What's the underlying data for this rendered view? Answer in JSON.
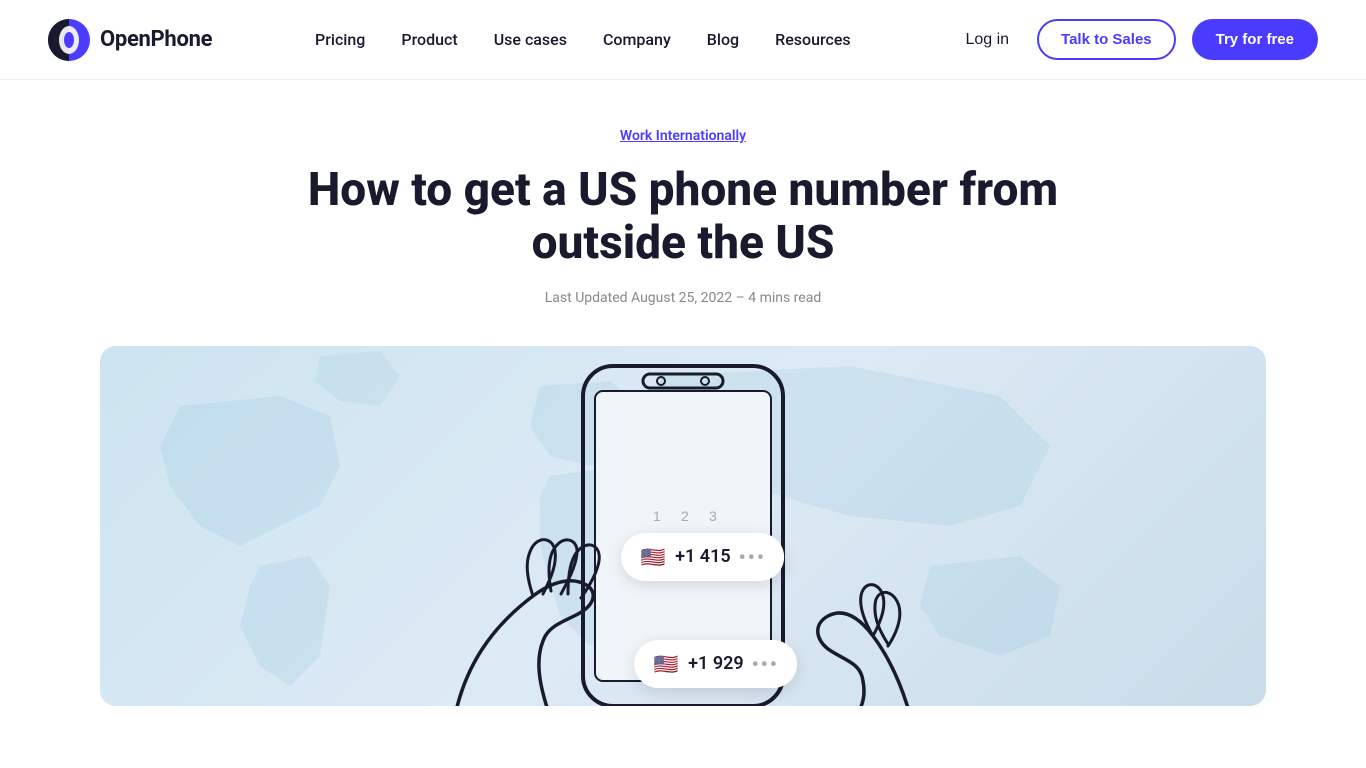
{
  "header": {
    "logo_text": "OpenPhone",
    "nav_items": [
      {
        "label": "Pricing",
        "id": "pricing"
      },
      {
        "label": "Product",
        "id": "product"
      },
      {
        "label": "Use cases",
        "id": "use-cases"
      },
      {
        "label": "Company",
        "id": "company"
      },
      {
        "label": "Blog",
        "id": "blog"
      },
      {
        "label": "Resources",
        "id": "resources"
      }
    ],
    "login_label": "Log in",
    "talk_sales_label": "Talk to Sales",
    "try_free_label": "Try for free"
  },
  "article": {
    "category": "Work Internationally",
    "title": "How to get a US phone number from outside the US",
    "meta": "Last Updated August 25, 2022 – 4 mins read"
  },
  "hero": {
    "bubble_top_number": "+1 415",
    "bubble_bottom_number": "+1 929"
  }
}
